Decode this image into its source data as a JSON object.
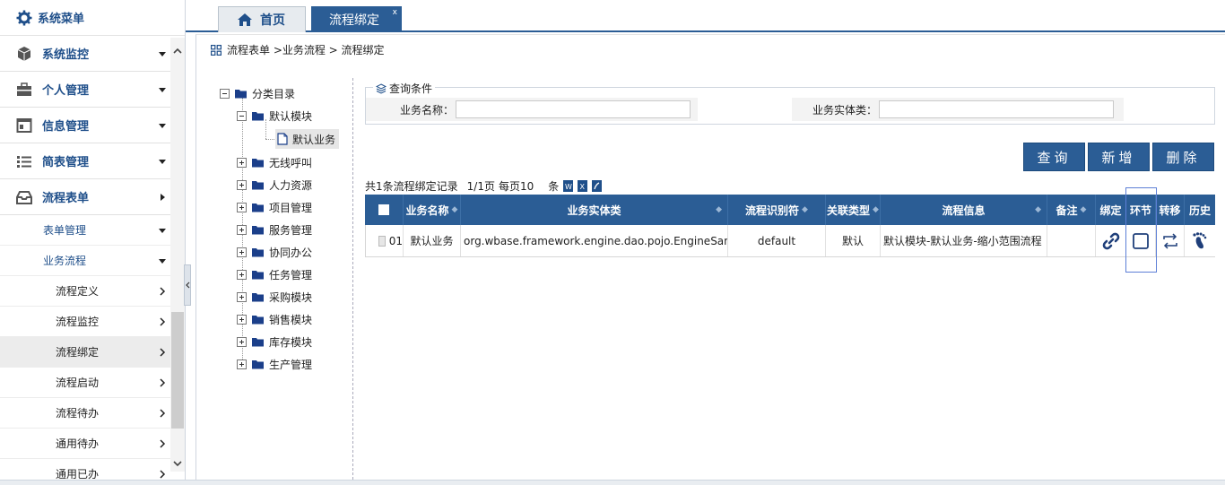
{
  "sidebar": {
    "title": "系统菜单",
    "menus": [
      {
        "label": "系统监控",
        "icon": "box-icon"
      },
      {
        "label": "个人管理",
        "icon": "briefcase-icon"
      },
      {
        "label": "信息管理",
        "icon": "window-icon"
      },
      {
        "label": "简表管理",
        "icon": "list-icon"
      },
      {
        "label": "流程表单",
        "icon": "inbox-icon"
      }
    ],
    "sub": {
      "form_mgmt": "表单管理",
      "biz_flow": "业务流程",
      "items": [
        "流程定义",
        "流程监控",
        "流程绑定",
        "流程启动",
        "流程待办",
        "通用待办",
        "通用已办"
      ]
    }
  },
  "tabs": {
    "home": "首页",
    "current": "流程绑定",
    "close": "x"
  },
  "breadcrumb": "流程表单 >业务流程 > 流程绑定",
  "tree": {
    "root": "分类目录",
    "default_module": "默认模块",
    "default_biz": "默认业务",
    "others": [
      "无线呼叫",
      "人力资源",
      "项目管理",
      "服务管理",
      "协同办公",
      "任务管理",
      "采购模块",
      "销售模块",
      "库存模块",
      "生产管理"
    ]
  },
  "query": {
    "legend": "查询条件",
    "name_label": "业务名称：",
    "name_value": "",
    "entity_label": "业务实体类：",
    "entity_value": ""
  },
  "buttons": {
    "search": "查询",
    "add": "新增",
    "delete": "删除"
  },
  "info": {
    "summary": "共1条流程绑定记录",
    "page": "1/1页",
    "per_page": "每页10",
    "unit": "条"
  },
  "table": {
    "headers": {
      "name": "业务名称",
      "entity": "业务实体类",
      "flow_id": "流程识别符",
      "rel_type": "关联类型",
      "flow_info": "流程信息",
      "remark": "备注",
      "bind": "绑定",
      "node": "环节",
      "transfer": "转移",
      "history": "历史"
    },
    "rows": [
      {
        "no": "01",
        "name": "默认业务",
        "entity": "org.wbase.framework.engine.dao.pojo.EngineSam...",
        "flow_id": "default",
        "rel_type": "默认",
        "flow_info": "默认模块-默认业务-缩小范围流程",
        "remark": ""
      }
    ]
  },
  "colors": {
    "primary": "#2b5d95",
    "nav_text": "#1f4f8a"
  }
}
